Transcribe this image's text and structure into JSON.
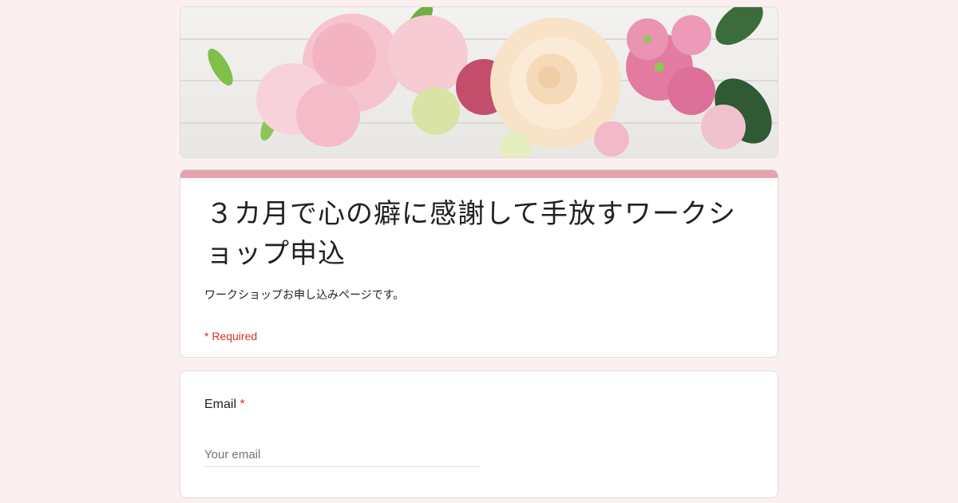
{
  "banner": {
    "image_name": "flower-bouquet-banner"
  },
  "form": {
    "title": "３カ月で心の癖に感謝して手放すワークショップ申込",
    "description": "ワークショップお申し込みページです。",
    "required_note": "* Required",
    "accent_color": "#e3a4ad"
  },
  "questions": {
    "email": {
      "label": "Email",
      "required_mark": "*",
      "placeholder": "Your email",
      "value": ""
    }
  },
  "colors": {
    "page_background": "#fbeff0",
    "required_red": "#d93025"
  }
}
